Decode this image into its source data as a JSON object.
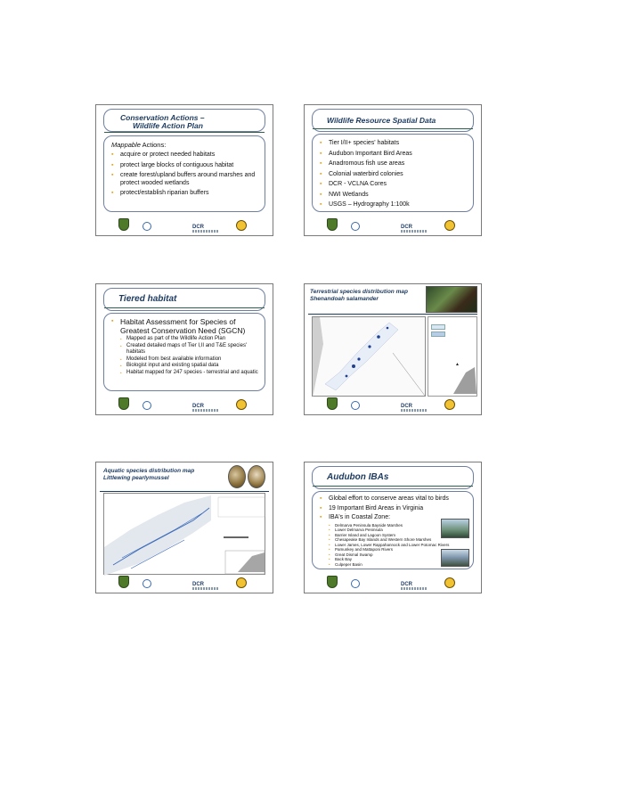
{
  "slides": [
    {
      "title_line1": "Conservation Actions –",
      "title_line2": "Wildlife Action Plan",
      "lead_italic": "Mappable",
      "lead_rest": " Actions:",
      "bullets": [
        "acquire or protect needed habitats",
        "protect large blocks of contiguous habitat",
        "create forest/upland buffers around marshes and protect wooded wetlands",
        "protect/establish riparian buffers"
      ]
    },
    {
      "title": "Wildlife Resource Spatial Data",
      "bullets": [
        "Tier I/II+ species' habitats",
        "Audubon Important Bird Areas",
        "Anadromous fish use areas",
        "Colonial waterbird colonies",
        "DCR - VCLNA Cores",
        "NWI Wetlands",
        "USGS – Hydrography 1:100k"
      ]
    },
    {
      "title": "Tiered habitat",
      "main": "Habitat Assessment for Species of Greatest Conservation Need (SGCN)",
      "sub": [
        "Mapped as part of the Wildlife Action Plan",
        "Created detailed maps of Tier I,II and T&E species' habitats",
        "Modeled from best available information",
        "Biologist input and existing spatial data",
        "Habitat mapped for 247 species - terrestrial and aquatic"
      ]
    },
    {
      "title_line1": "Terrestrial species distribution map",
      "title_line2": "Shenandoah salamander"
    },
    {
      "title_line1": "Aquatic species distribution map",
      "title_line2": "Littlewing pearlymussel"
    },
    {
      "title": "Audubon IBAs",
      "bullets": [
        "Global effort to conserve areas vital to birds",
        "19 Important Bird Areas in Virginia",
        "IBA's in Coastal Zone:"
      ],
      "sub": [
        "Delmarva Peninsula Bayside Marshes",
        "Lower Delmarva Peninsula",
        "Barrier Island and Lagoon System",
        "Chesapeake Bay Islands and Western Shore Marshes",
        "Lower James, Lower Rappahannock and Lower Potomac Rivers",
        "Pamunkey and Mattaponi Rivers",
        "Great Dismal Swamp",
        "Back Bay",
        "Culpeper Basin"
      ]
    }
  ],
  "footer": {
    "dcr": "DCR"
  }
}
